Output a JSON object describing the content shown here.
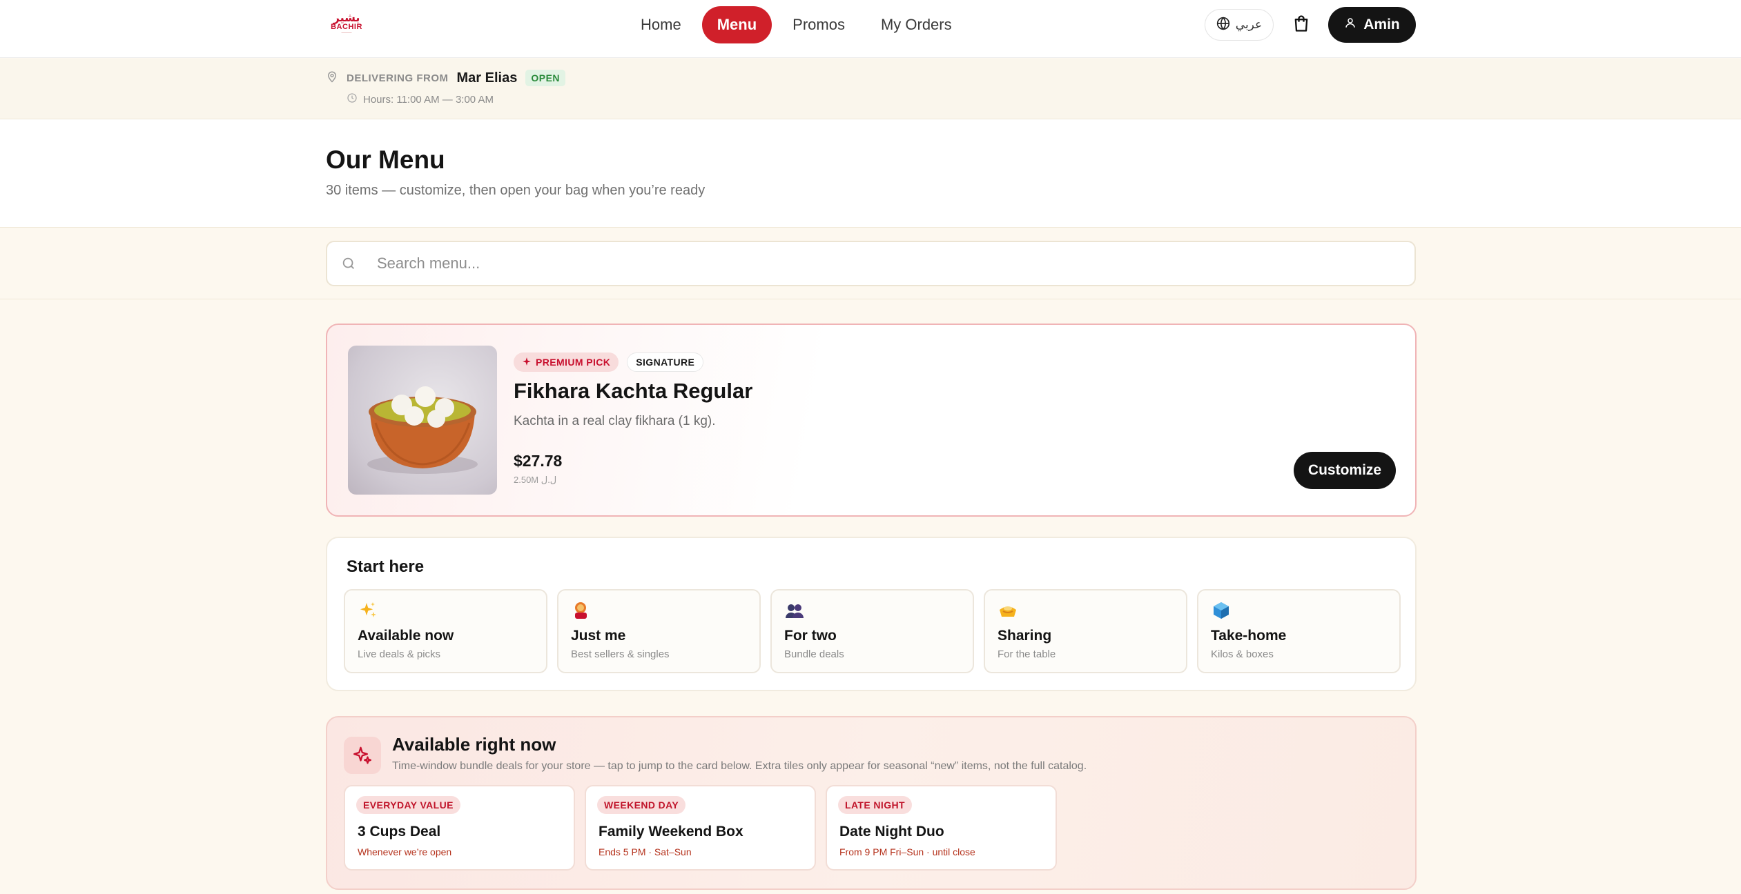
{
  "brand": {
    "logo_ar": "بشير",
    "logo_en": "BACHIR",
    "color": "#d0202a"
  },
  "nav": {
    "items": [
      {
        "label": "Home",
        "active": false
      },
      {
        "label": "Menu",
        "active": true
      },
      {
        "label": "Promos",
        "active": false
      },
      {
        "label": "My Orders",
        "active": false
      }
    ],
    "language_label": "عربي",
    "user_label": "Amin"
  },
  "delivery": {
    "label": "DELIVERING FROM",
    "store": "Mar Elias",
    "status": "OPEN",
    "hours": "Hours: 11:00 AM — 3:00 AM"
  },
  "header": {
    "title": "Our Menu",
    "subtitle": "30 items — customize, then open your bag when you’re ready"
  },
  "search": {
    "placeholder": "Search menu...",
    "value": ""
  },
  "premium": {
    "chip_primary": "PREMIUM PICK",
    "chip_secondary": "SIGNATURE",
    "title": "Fikhara Kachta Regular",
    "description": "Kachta in a real clay fikhara (1 kg).",
    "price": "$27.78",
    "price_lbp": "2.50M ل.ل",
    "button_label": "Customize"
  },
  "start_here": {
    "title": "Start here",
    "tiles": [
      {
        "title": "Available now",
        "subtitle": "Live deals & picks",
        "icon": "sparkles-icon"
      },
      {
        "title": "Just me",
        "subtitle": "Best sellers & singles",
        "icon": "person-icon"
      },
      {
        "title": "For two",
        "subtitle": "Bundle deals",
        "icon": "two-people-icon"
      },
      {
        "title": "Sharing",
        "subtitle": "For the table",
        "icon": "sharing-icon"
      },
      {
        "title": "Take-home",
        "subtitle": "Kilos & boxes",
        "icon": "box-icon"
      }
    ]
  },
  "available_now": {
    "title": "Available right now",
    "subtitle": "Time-window bundle deals for your store — tap to jump to the card below. Extra tiles only appear for seasonal “new” items, not the full catalog.",
    "deals": [
      {
        "tag": "EVERYDAY VALUE",
        "title": "3 Cups Deal",
        "subtitle": "Whenever we’re open"
      },
      {
        "tag": "WEEKEND DAY",
        "title": "Family Weekend Box",
        "subtitle": "Ends 5 PM · Sat–Sun"
      },
      {
        "tag": "LATE NIGHT",
        "title": "Date Night Duo",
        "subtitle": "From 9 PM Fri–Sun · until close"
      }
    ]
  }
}
